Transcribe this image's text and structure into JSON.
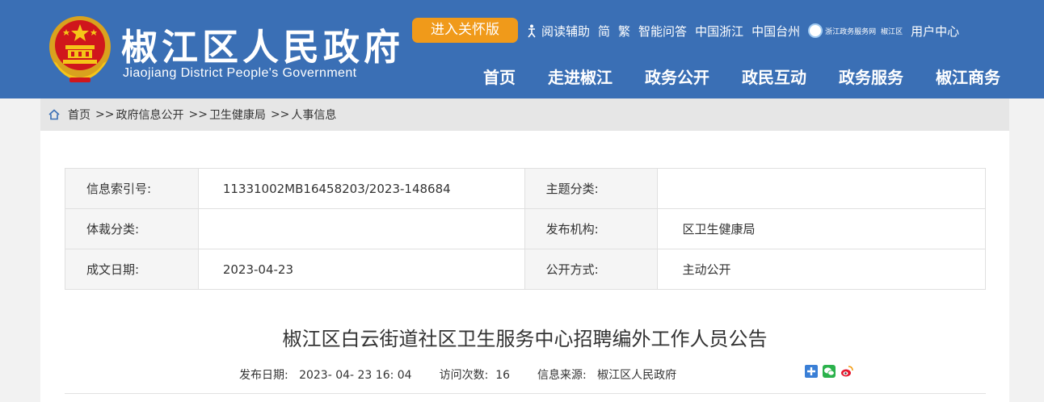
{
  "header": {
    "title": "椒江区人民政府",
    "subtitle": "Jiaojiang District People's Government",
    "care_button": "进入关怀版",
    "top_links": {
      "reading": "阅读辅助",
      "simplified": "简",
      "traditional": "繁",
      "qa": "智能问答",
      "china_zhejiang": "中国浙江",
      "china_taizhou": "中国台州",
      "zj_service": "浙江政务服务网",
      "jiaojiang": "椒江区",
      "user_center": "用户中心"
    },
    "nav": [
      "首页",
      "走进椒江",
      "政务公开",
      "政民互动",
      "政务服务",
      "椒江商务"
    ]
  },
  "breadcrumb": [
    "首页",
    "政府信息公开",
    "卫生健康局",
    "人事信息"
  ],
  "breadcrumb_sep": ">>",
  "meta": {
    "index_label": "信息索引号:",
    "index_value": "11331002MB16458203/2023-148684",
    "topic_label": "主题分类:",
    "topic_value": "",
    "genre_label": "体裁分类:",
    "genre_value": "",
    "publisher_label": "发布机构:",
    "publisher_value": "区卫生健康局",
    "date_label": "成文日期:",
    "date_value": "2023-04-23",
    "open_label": "公开方式:",
    "open_value": "主动公开"
  },
  "article": {
    "title": "椒江区白云街道社区卫生服务中心招聘编外工作人员公告",
    "publish_label": "发布日期:",
    "publish_value": "2023- 04- 23 16: 04",
    "visits_label": "访问次数:",
    "visits_value": "16",
    "source_label": "信息来源:",
    "source_value": "椒江区人民政府"
  },
  "colors": {
    "header_bg": "#3a6fb5",
    "care_button": "#f09a1a",
    "breadcrumb_bg": "#e6e6e6"
  }
}
